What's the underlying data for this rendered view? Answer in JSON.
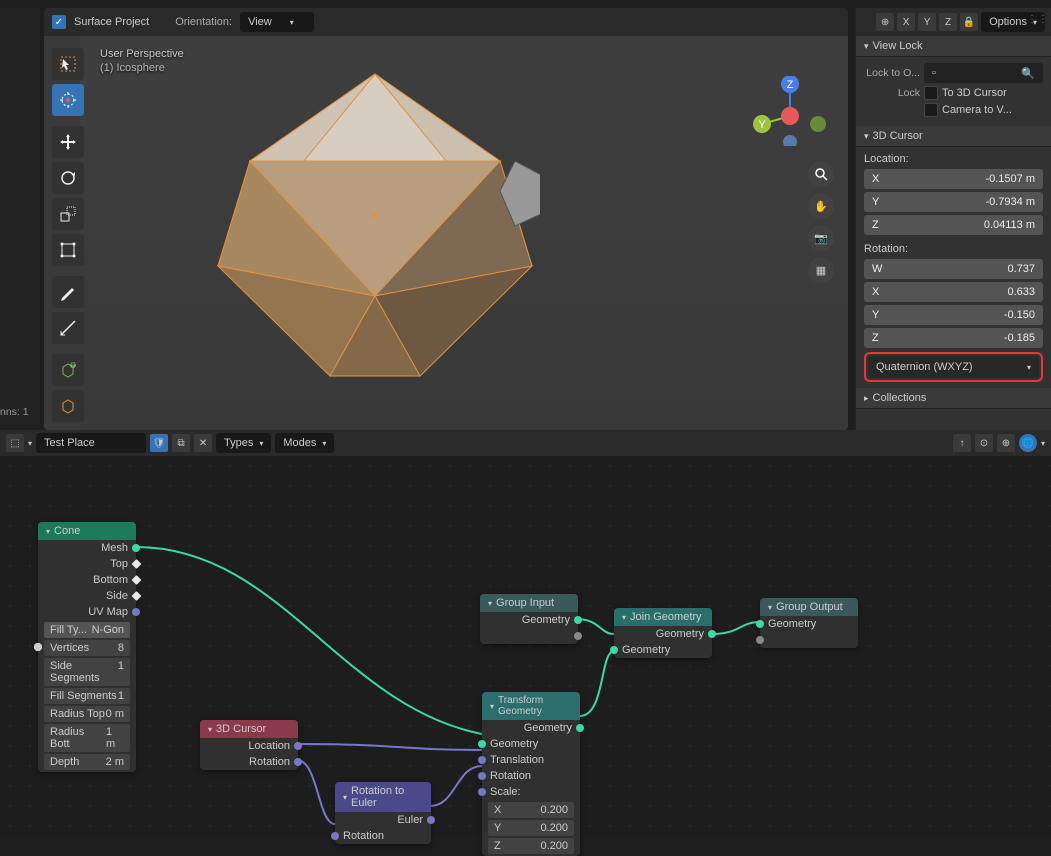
{
  "header": {
    "surface_project_label": "Surface Project",
    "surface_project_checked": true,
    "orientation_label": "Orientation:",
    "orientation_value": "View",
    "options_label": "Options"
  },
  "axis_buttons": [
    "X",
    "Y",
    "Z"
  ],
  "viewport": {
    "perspective_line1": "User Perspective",
    "perspective_line2": "(1) Icosphere"
  },
  "status_bar": {
    "columns": "nns: 1"
  },
  "sidebar": {
    "view_lock": {
      "title": "View Lock",
      "lock_to_label": "Lock to O...",
      "lock_label": "Lock",
      "to_3d_cursor": "To 3D Cursor",
      "camera_to_view": "Camera to V..."
    },
    "cursor": {
      "title": "3D Cursor",
      "location_label": "Location:",
      "location": {
        "X": "-0.1507 m",
        "Y": "-0.7934 m",
        "Z": "0.04113 m"
      },
      "rotation_label": "Rotation:",
      "rotation": {
        "W": "0.737",
        "X": "0.633",
        "Y": "-0.150",
        "Z": "-0.185"
      },
      "rotation_mode": "Quaternion (WXYZ)"
    },
    "collections": {
      "title": "Collections"
    }
  },
  "node_editor": {
    "name": "Test Place",
    "types_label": "Types",
    "modes_label": "Modes"
  },
  "nodes": {
    "cone": {
      "title": "Cone",
      "outputs": [
        "Mesh",
        "Top",
        "Bottom",
        "Side",
        "UV Map"
      ],
      "fill_type_label": "Fill Ty...",
      "fill_type_value": "N-Gon",
      "params": [
        {
          "label": "Vertices",
          "value": "8"
        },
        {
          "label": "Side Segments",
          "value": "1"
        },
        {
          "label": "Fill Segments",
          "value": "1"
        },
        {
          "label": "Radius Top",
          "value": "0 m"
        },
        {
          "label": "Radius Bott",
          "value": "1 m"
        },
        {
          "label": "Depth",
          "value": "2 m"
        }
      ]
    },
    "cursor3d": {
      "title": "3D Cursor",
      "outputs": [
        "Location",
        "Rotation"
      ]
    },
    "rot2euler": {
      "title": "Rotation to Euler",
      "output": "Euler",
      "input": "Rotation"
    },
    "group_input": {
      "title": "Group Input",
      "output": "Geometry"
    },
    "transform": {
      "title": "Transform Geometry",
      "output": "Geometry",
      "inputs": [
        "Geometry",
        "Translation",
        "Rotation"
      ],
      "scale_label": "Scale:",
      "scale": {
        "X": "0.200",
        "Y": "0.200",
        "Z": "0.200"
      }
    },
    "join": {
      "title": "Join Geometry",
      "output": "Geometry",
      "input": "Geometry"
    },
    "group_output": {
      "title": "Group Output",
      "input": "Geometry"
    }
  }
}
